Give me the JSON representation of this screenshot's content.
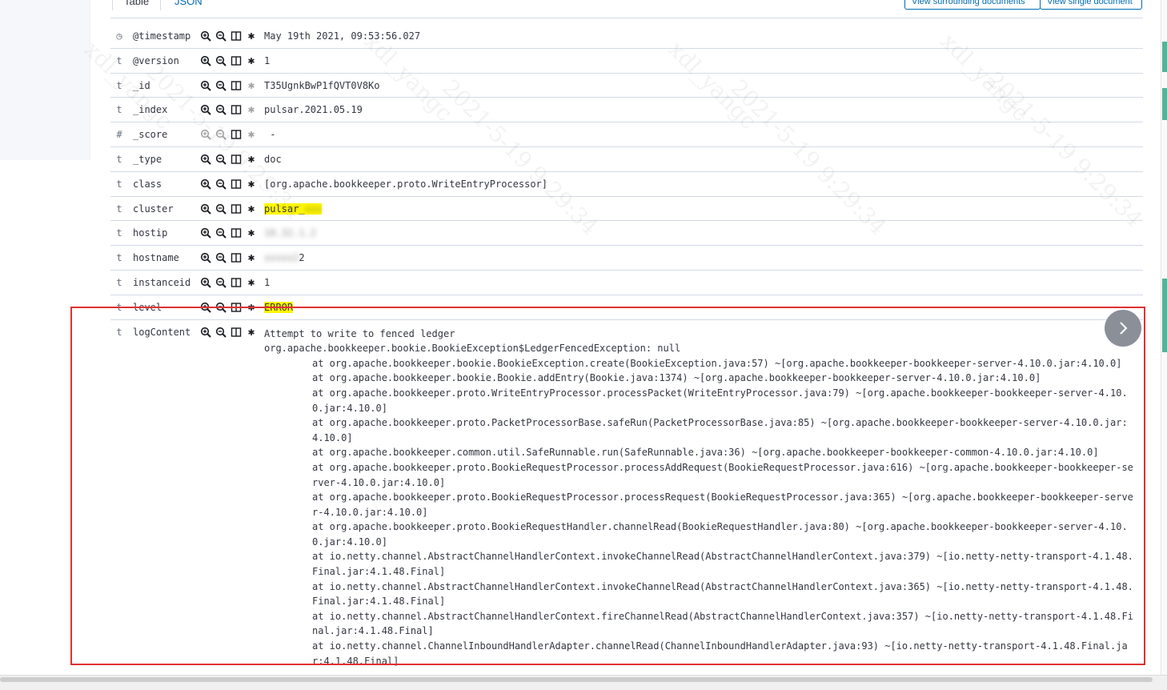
{
  "tabs": {
    "table": "Table",
    "json": "JSON"
  },
  "links": {
    "surrounding": "View surrounding documents",
    "single": "View single document"
  },
  "fields": [
    {
      "type": "clock",
      "type_glyph": "◷",
      "name": "@timestamp",
      "value": "May 19th 2021, 09:53:56.027",
      "highlight": false,
      "blurred": false,
      "aggregatable": true
    },
    {
      "type": "string",
      "type_glyph": "t",
      "name": "@version",
      "value": "1",
      "highlight": false,
      "blurred": false,
      "aggregatable": true
    },
    {
      "type": "string",
      "type_glyph": "t",
      "name": "_id",
      "value": "T35UgnkBwP1fQVT0V8Ko",
      "highlight": false,
      "blurred": false,
      "aggregatable": false
    },
    {
      "type": "string",
      "type_glyph": "t",
      "name": "_index",
      "value": "pulsar.2021.05.19",
      "highlight": false,
      "blurred": false,
      "aggregatable": false
    },
    {
      "type": "number",
      "type_glyph": "#",
      "name": "_score",
      "value": " -",
      "highlight": false,
      "blurred": false,
      "aggregatable": false,
      "dim_zoom": true
    },
    {
      "type": "string",
      "type_glyph": "t",
      "name": "_type",
      "value": "doc",
      "highlight": false,
      "blurred": false,
      "aggregatable": true
    },
    {
      "type": "string",
      "type_glyph": "t",
      "name": "class",
      "value": "[org.apache.bookkeeper.proto.WriteEntryProcessor]",
      "highlight": false,
      "blurred": false,
      "aggregatable": true
    },
    {
      "type": "string",
      "type_glyph": "t",
      "name": "cluster",
      "value": "pulsar_",
      "highlight": true,
      "blurred": false,
      "aggregatable": true,
      "blur_suffix": "xxx"
    },
    {
      "type": "string",
      "type_glyph": "t",
      "name": "hostip",
      "value": "10.32.1.2",
      "highlight": false,
      "blurred": true,
      "aggregatable": true
    },
    {
      "type": "string",
      "type_glyph": "t",
      "name": "hostname",
      "value": "xxxxx2",
      "highlight": false,
      "blurred": true,
      "aggregatable": true,
      "blur_keep_last": "2"
    },
    {
      "type": "string",
      "type_glyph": "t",
      "name": "instanceid",
      "value": "1",
      "highlight": false,
      "blurred": false,
      "aggregatable": true
    },
    {
      "type": "string",
      "type_glyph": "t",
      "name": "level",
      "value": "ERROR",
      "highlight": true,
      "blurred": false,
      "aggregatable": true
    }
  ],
  "log": {
    "type_glyph": "t",
    "name": "logContent",
    "lines": [
      {
        "indent": false,
        "text": "Attempt to write to fenced ledger"
      },
      {
        "indent": false,
        "text": "org.apache.bookkeeper.bookie.BookieException$LedgerFencedException: null"
      },
      {
        "indent": true,
        "text": "at org.apache.bookkeeper.bookie.BookieException.create(BookieException.java:57) ~[org.apache.bookkeeper-bookkeeper-server-4.10.0.jar:4.10.0]"
      },
      {
        "indent": true,
        "text": "at org.apache.bookkeeper.bookie.Bookie.addEntry(Bookie.java:1374) ~[org.apache.bookkeeper-bookkeeper-server-4.10.0.jar:4.10.0]"
      },
      {
        "indent": true,
        "text": "at org.apache.bookkeeper.proto.WriteEntryProcessor.processPacket(WriteEntryProcessor.java:79) ~[org.apache.bookkeeper-bookkeeper-server-4.10.0.jar:4.10.0]"
      },
      {
        "indent": true,
        "text": "at org.apache.bookkeeper.proto.PacketProcessorBase.safeRun(PacketProcessorBase.java:85) ~[org.apache.bookkeeper-bookkeeper-server-4.10.0.jar:4.10.0]"
      },
      {
        "indent": true,
        "text": "at org.apache.bookkeeper.common.util.SafeRunnable.run(SafeRunnable.java:36) ~[org.apache.bookkeeper-bookkeeper-common-4.10.0.jar:4.10.0]"
      },
      {
        "indent": true,
        "text": "at org.apache.bookkeeper.proto.BookieRequestProcessor.processAddRequest(BookieRequestProcessor.java:616) ~[org.apache.bookkeeper-bookkeeper-server-4.10.0.jar:4.10.0]"
      },
      {
        "indent": true,
        "text": "at org.apache.bookkeeper.proto.BookieRequestProcessor.processRequest(BookieRequestProcessor.java:365) ~[org.apache.bookkeeper-bookkeeper-server-4.10.0.jar:4.10.0]"
      },
      {
        "indent": true,
        "text": "at org.apache.bookkeeper.proto.BookieRequestHandler.channelRead(BookieRequestHandler.java:80) ~[org.apache.bookkeeper-bookkeeper-server-4.10.0.jar:4.10.0]"
      },
      {
        "indent": true,
        "text": "at io.netty.channel.AbstractChannelHandlerContext.invokeChannelRead(AbstractChannelHandlerContext.java:379) ~[io.netty-netty-transport-4.1.48.Final.jar:4.1.48.Final]"
      },
      {
        "indent": true,
        "text": "at io.netty.channel.AbstractChannelHandlerContext.invokeChannelRead(AbstractChannelHandlerContext.java:365) ~[io.netty-netty-transport-4.1.48.Final.jar:4.1.48.Final]"
      },
      {
        "indent": true,
        "text": "at io.netty.channel.AbstractChannelHandlerContext.fireChannelRead(AbstractChannelHandlerContext.java:357) ~[io.netty-netty-transport-4.1.48.Final.jar:4.1.48.Final]"
      },
      {
        "indent": true,
        "text": "at io.netty.channel.ChannelInboundHandlerAdapter.channelRead(ChannelInboundHandlerAdapter.java:93) ~[io.netty-netty-transport-4.1.48.Final.jar:4.1.48.Final]"
      }
    ]
  },
  "watermark": {
    "text1": "xdl_yangc",
    "text2": "2021-5-19  9:29:34"
  },
  "colors": {
    "highlight": "#fff700",
    "link": "#006bb4",
    "frame": "#e03131",
    "nav": "#8a8f98"
  },
  "icons": {
    "zoom_in": "magnify-plus-icon",
    "zoom_out": "magnify-minus-icon",
    "column": "column-toggle-icon",
    "exists": "asterisk-icon",
    "next": "chevron-right-icon"
  }
}
